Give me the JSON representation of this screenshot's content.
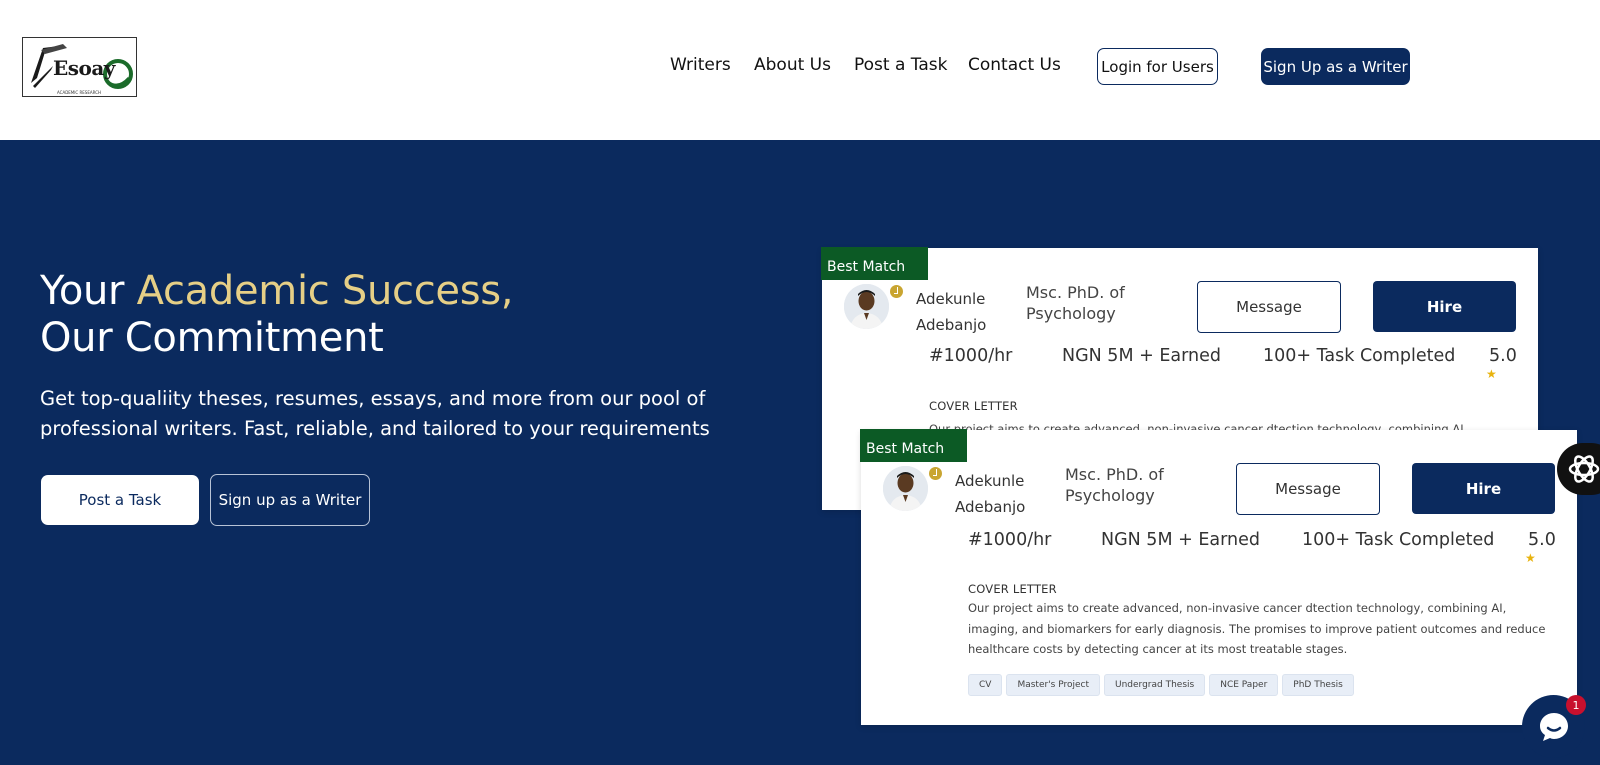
{
  "header": {
    "logo_text": "Esoay",
    "logo_subtext": "ACADEMIC RESEARCH",
    "nav": [
      "Writers",
      "About Us",
      "Post a Task",
      "Contact Us"
    ],
    "login_label": "Login for Users",
    "signup_label": "Sign Up as a Writer"
  },
  "hero": {
    "title_part1": "Your ",
    "title_accent": "Academic Success,",
    "title_part2": "Our Commitment",
    "subtitle": "Get top-qualiity theses, resumes, essays, and more from our pool of professional writers. Fast, reliable, and tailored to your requirements",
    "post_task_label": "Post a Task",
    "sign_up_writer_label": "Sign up as a Writer"
  },
  "cards": [
    {
      "badge": "Best Match",
      "name_first": "Adekunle",
      "name_last": "Adebanjo",
      "degree_line1": "Msc. PhD. of",
      "degree_line2": "Psychology",
      "message_label": "Message",
      "hire_label": "Hire",
      "rate": "#1000/hr",
      "earned": "NGN 5M + Earned",
      "tasks": "100+ Task Completed",
      "rating": "5.0",
      "cover_letter_label": "COVER LETTER",
      "cover_letter": "Our project aims to create advanced, non-invasive cancer dtection technology, combining AI, imaging, and"
    },
    {
      "badge": "Best Match",
      "name_first": "Adekunle",
      "name_last": "Adebanjo",
      "degree_line1": "Msc. PhD. of",
      "degree_line2": "Psychology",
      "message_label": "Message",
      "hire_label": "Hire",
      "rate": "#1000/hr",
      "earned": "NGN 5M + Earned",
      "tasks": "100+ Task Completed",
      "rating": "5.0",
      "cover_letter_label": "COVER LETTER",
      "cover_letter": "Our project aims to create advanced, non-invasive cancer dtection technology, combining AI, imaging, and biomarkers for early diagnosis. The promises to improve patient outcomes and reduce healthcare costs by detecting cancer at its most treatable stages.",
      "tags": [
        "CV",
        "Master's Project",
        "Undergrad Thesis",
        "NCE Paper",
        "PhD Thesis"
      ]
    }
  ],
  "chat": {
    "badge_count": "1"
  },
  "colors": {
    "navy": "#0b2a5e",
    "accent": "#e6cf86",
    "badge_green": "#0c5a25",
    "star": "#e8b30e"
  },
  "icons": [
    "verified-badge-icon",
    "star-icon",
    "chat-icon",
    "ai-assistant-icon"
  ]
}
